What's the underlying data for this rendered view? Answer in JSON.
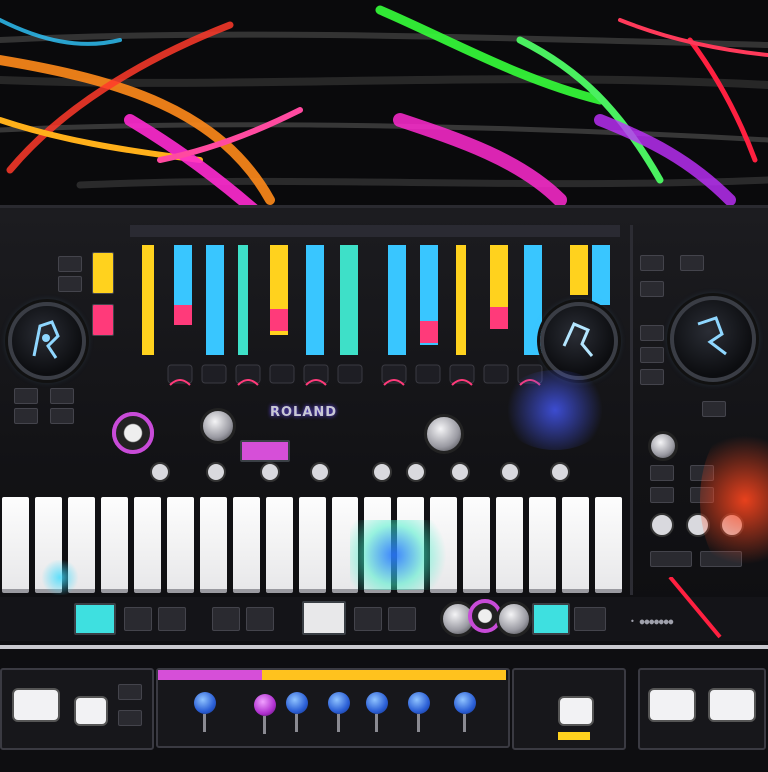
{
  "brand": {
    "text": "ROLAND"
  },
  "label_bottom_right": {
    "text": "• ●●●●●●●"
  },
  "colors": {
    "background": "#0b0b0d",
    "panel": "#16161a",
    "streak_red": "#ff2a3a",
    "streak_magenta": "#ff2ad0",
    "streak_green": "#35ff3a",
    "streak_orange": "#ff8a1a",
    "fader_cyan": "#39c6ff",
    "fader_yellow": "#ffd21e",
    "fader_pink": "#ff3a7a",
    "knob_blue": "#2b5fd6",
    "accent_purple": "#c84bd8"
  },
  "icons": {
    "left_dial": "jog-wheel-icon",
    "mid_dial": "jog-wheel-icon",
    "right_dial": "jog-wheel-icon",
    "pads": "drum-pad-icon"
  },
  "pads": {
    "count": 19
  }
}
